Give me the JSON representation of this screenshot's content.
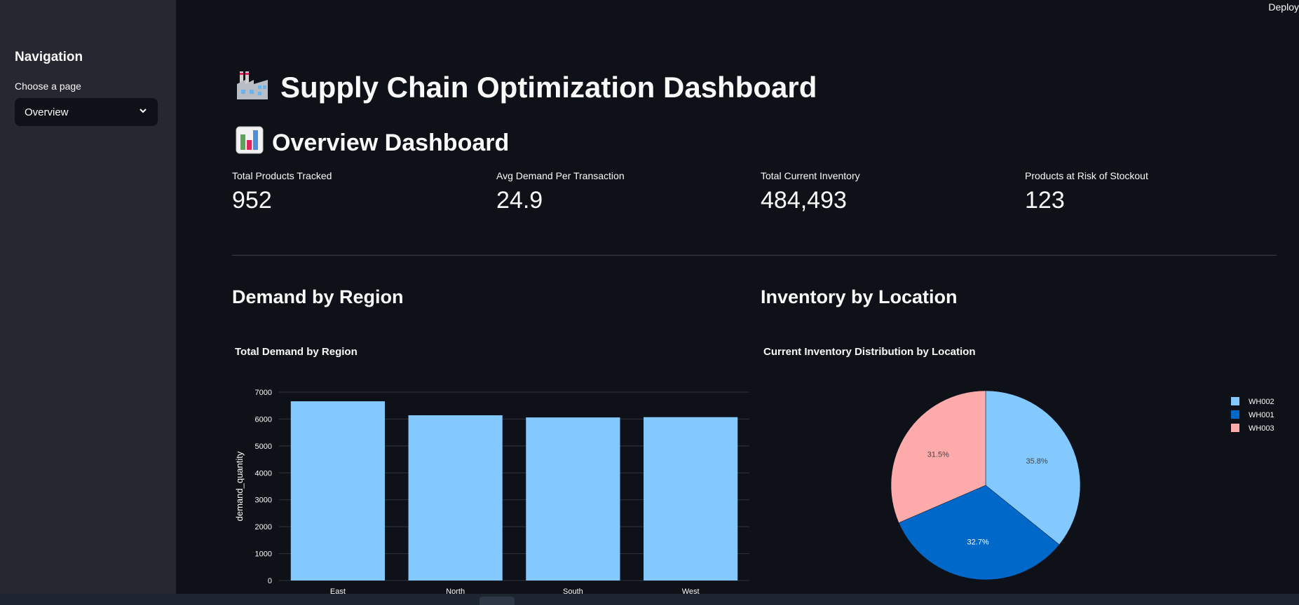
{
  "header": {
    "deploy_label": "Deploy"
  },
  "sidebar": {
    "title": "Navigation",
    "select_label": "Choose a page",
    "selected": "Overview"
  },
  "main": {
    "title": "Supply Chain Optimization Dashboard",
    "title_icon": "factory-icon",
    "subtitle": "Overview Dashboard",
    "subtitle_icon": "bar-chart-icon"
  },
  "metrics": [
    {
      "label": "Total Products Tracked",
      "value": "952"
    },
    {
      "label": "Avg Demand Per Transaction",
      "value": "24.9"
    },
    {
      "label": "Total Current Inventory",
      "value": "484,493"
    },
    {
      "label": "Products at Risk of Stockout",
      "value": "123"
    }
  ],
  "sections": {
    "demand": "Demand by Region",
    "inventory": "Inventory by Location"
  },
  "chart_data": [
    {
      "type": "bar",
      "title": "Total Demand by Region",
      "categories": [
        "East",
        "North",
        "South",
        "West"
      ],
      "values": [
        6660,
        6140,
        6060,
        6070
      ],
      "xlabel": "",
      "ylabel": "demand_quantity",
      "ylim": [
        0,
        7000
      ],
      "yticks": [
        0,
        1000,
        2000,
        3000,
        4000,
        5000,
        6000,
        7000
      ],
      "grid": true,
      "color": "#83c9ff"
    },
    {
      "type": "pie",
      "title": "Current Inventory Distribution by Location",
      "labels": [
        "WH002",
        "WH001",
        "WH003"
      ],
      "values": [
        35.8,
        32.7,
        31.5
      ],
      "value_labels": [
        "35.8%",
        "32.7%",
        "31.5%"
      ],
      "colors": [
        "#83c9ff",
        "#0068c9",
        "#ffabab"
      ],
      "legend": "top-right"
    }
  ]
}
